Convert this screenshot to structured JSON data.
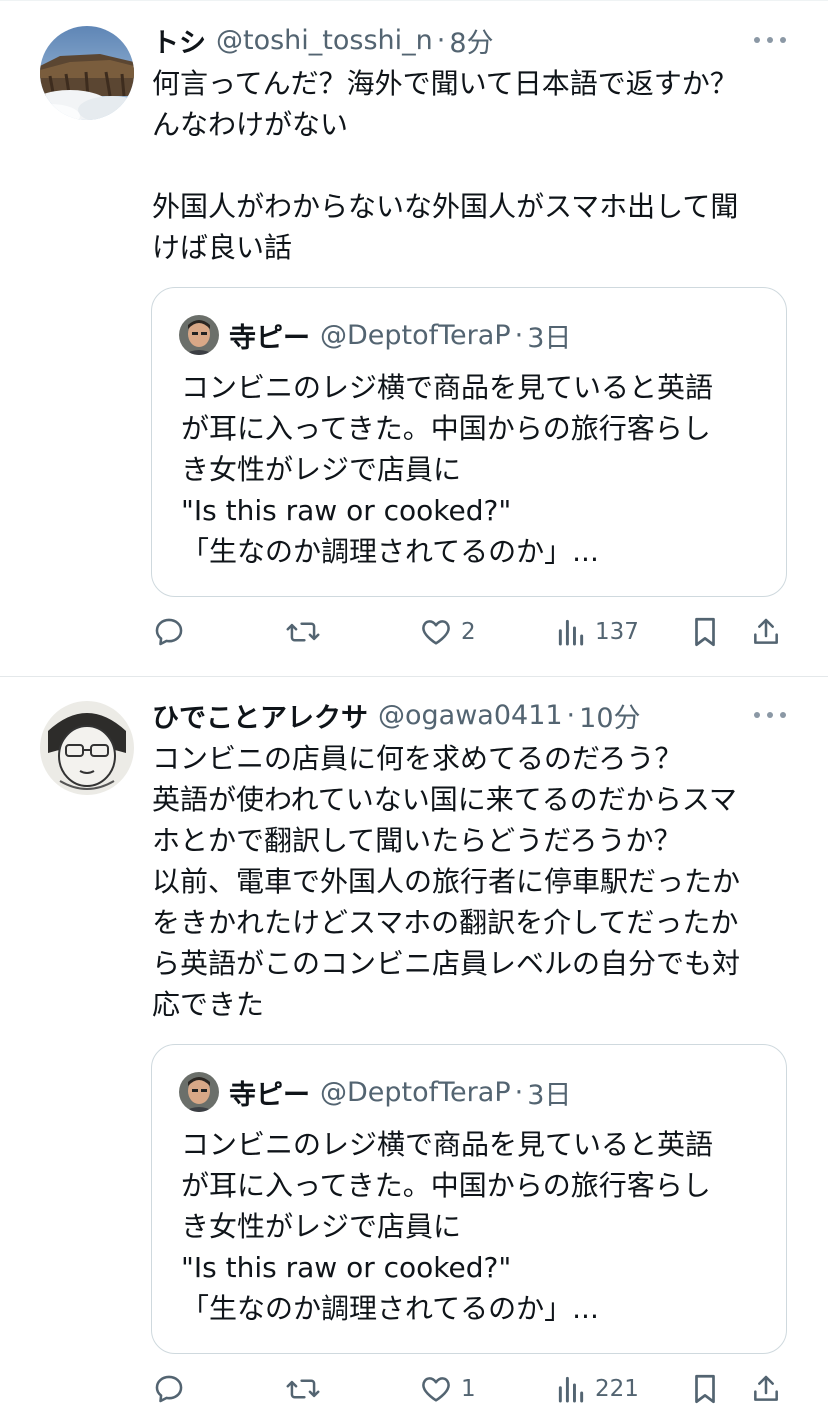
{
  "tweets": [
    {
      "name": "トシ",
      "handle": "@toshi_tosshi_n",
      "separator": "·",
      "time": "8分",
      "body": [
        "何言ってんだ？海外で聞いて日本語で返すか？",
        "んなわけがない",
        "",
        "外国人がわからないな外国人がスマホ出して聞",
        "けば良い話"
      ],
      "avatar_icon": "cliff-landscape-avatar",
      "quote": {
        "name": "寺ピー",
        "handle": "@DeptofTeraP",
        "separator": "·",
        "time": "3日",
        "body": [
          "コンビニのレジ横で商品を見ていると英語",
          "が耳に入ってきた。中国からの旅行客らし",
          "き女性がレジで店員に",
          "\"Is this raw or cooked?\"",
          "「生なのか調理されてるのか」..."
        ]
      },
      "replies": "",
      "retweets": "",
      "likes": "2",
      "views": "137"
    },
    {
      "name": "ひでことアレクサ",
      "handle": "@ogawa0411",
      "separator": "·",
      "time": "10分",
      "body": [
        "コンビニの店員に何を求めてるのだろう？",
        "英語が使われていない国に来てるのだからスマ",
        "ホとかで翻訳して聞いたらどうだろうか？",
        "以前、電車で外国人の旅行者に停車駅だったか",
        "をきかれたけどスマホの翻訳を介してだったか",
        "ら英語がこのコンビニ店員レベルの自分でも対",
        "応できた"
      ],
      "avatar_icon": "drawn-face-avatar",
      "quote": {
        "name": "寺ピー",
        "handle": "@DeptofTeraP",
        "separator": "·",
        "time": "3日",
        "body": [
          "コンビニのレジ横で商品を見ていると英語",
          "が耳に入ってきた。中国からの旅行客らし",
          "き女性がレジで店員に",
          "\"Is this raw or cooked?\"",
          "「生なのか調理されてるのか」..."
        ]
      },
      "replies": "",
      "retweets": "",
      "likes": "1",
      "views": "221"
    }
  ],
  "icons": {
    "reply": "reply-icon",
    "retweet": "retweet-icon",
    "like": "heart-icon",
    "views": "views-chart-icon",
    "bookmark": "bookmark-icon",
    "share": "share-icon",
    "more": "more-dots-icon"
  },
  "colors": {
    "text": "#0f1419",
    "secondary": "#536471",
    "border": "#cfd9de"
  }
}
